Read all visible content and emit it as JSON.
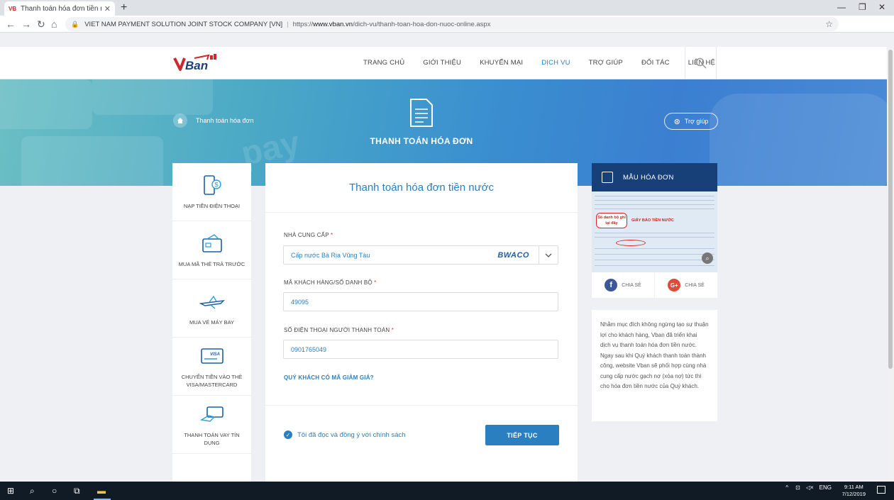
{
  "browser": {
    "tab_title": "Thanh toán hóa đơn tiền nước, h",
    "favicon_text": "VB",
    "org": "VIET NAM PAYMENT SOLUTION JOINT STOCK COMPANY [VN]",
    "url_prefix": "https://",
    "url_host": "www.vban.vn",
    "url_path": "/dich-vu/thanh-toan-hoa-don-nuoc-online.aspx"
  },
  "site": {
    "logo_text": "VBan",
    "menu": [
      "TRANG CHỦ",
      "GIỚI THIỆU",
      "KHUYẾN MẠI",
      "DỊCH VỤ",
      "TRỢ GIÚP",
      "ĐỐI TÁC",
      "LIÊN HỆ"
    ],
    "active_menu": "DỊCH VỤ"
  },
  "hero": {
    "breadcrumb": "Thanh toán hóa đơn",
    "title": "THANH TOÁN HÓA ĐƠN",
    "help_label": "Trợ giúp",
    "background_word": "pay"
  },
  "services": [
    {
      "label": "NẠP TIỀN ĐIỆN THOẠI",
      "icon": "phone-money-icon"
    },
    {
      "label": "MUA MÃ THẺ TRẢ TRƯỚC",
      "icon": "prepaid-card-icon"
    },
    {
      "label": "MUA VÉ MÁY BAY",
      "icon": "airplane-icon"
    },
    {
      "label": "CHUYỂN TIỀN VÀO THẺ VISA/MASTERCARD",
      "icon": "visa-card-icon"
    },
    {
      "label": "THANH TOÁN VAY TÍN DỤNG",
      "icon": "credit-loan-icon"
    }
  ],
  "form": {
    "title": "Thanh toán hóa đơn tiền nước",
    "provider_label": "NHÀ CUNG CẤP",
    "provider_value": "Cấp nước Bà Rịa Vũng Tàu",
    "provider_logo": "BWACO",
    "customer_label": "MÃ KHÁCH HÀNG/SỐ DANH BỘ",
    "customer_value": "49095",
    "phone_label": "SỐ ĐIỆN THOẠI NGƯỜI THANH TOÁN",
    "phone_value": "0901765049",
    "required_mark": "*",
    "promo_link": "QUÝ KHÁCH CÓ MÃ GIẢM GIÁ?",
    "agree_text": "Tôi đã đọc và đồng ý với chính sách",
    "submit_label": "TIẾP TỤC"
  },
  "sample": {
    "title": "MẪU HÓA ĐƠN",
    "invoice_note": "Số danh bộ ghi tại đây",
    "invoice_heading": "GIẤY BÁO TIỀN NƯỚC",
    "share_facebook": "CHIA SẺ",
    "share_google": "CHIA SẺ"
  },
  "description": "Nhằm mục đích không ngừng tạo sự thuận lợi cho khách hàng, Vban đã triển khai dịch vụ thanh toán hóa đơn tiền nước. Ngay sau khi Quý khách thanh toán thành công, website Vban sẽ phối hợp cùng nhà cung cấp nước gạch nợ (xóa nợ) tức thì cho hóa đơn tiền nước của Quý khách.",
  "taskbar": {
    "language": "ENG",
    "time": "9:11 AM",
    "date": "7/12/2019"
  },
  "colors": {
    "accent": "#2a7fc0",
    "dark_header": "#173f78"
  }
}
